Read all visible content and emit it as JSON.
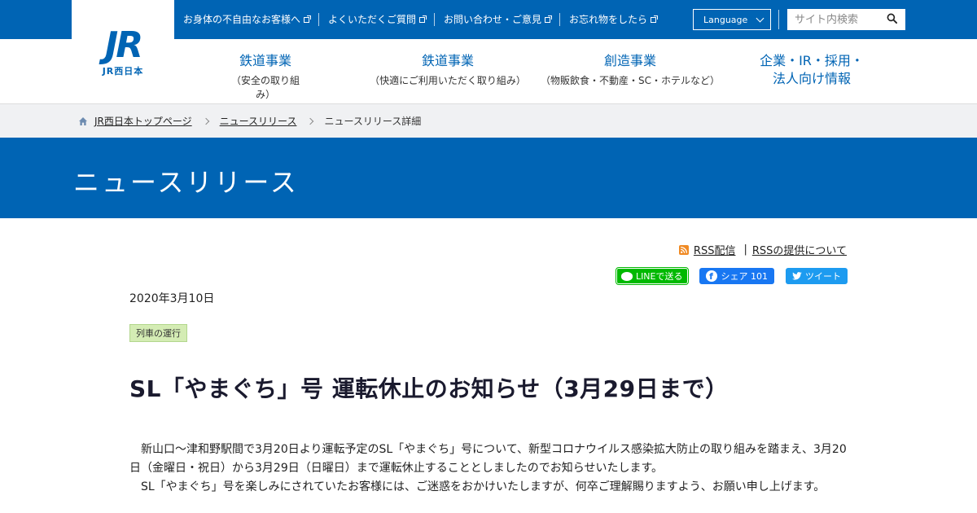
{
  "brand": {
    "logo_text": "JR",
    "logo_sub": "JR西日本"
  },
  "utility_links": [
    {
      "label": "お身体の不自由なお客様へ"
    },
    {
      "label": "よくいただくご質問"
    },
    {
      "label": "お問い合わせ・ご意見"
    },
    {
      "label": "お忘れ物をしたら"
    }
  ],
  "language": {
    "label": "Language"
  },
  "search": {
    "placeholder": "サイト内検索"
  },
  "main_nav": [
    {
      "title": "鉄道事業",
      "sub": "（安全の取り組み）"
    },
    {
      "title": "鉄道事業",
      "sub": "（快適にご利用いただく取り組み）"
    },
    {
      "title": "創造事業",
      "sub": "（物販飲食・不動産・SC・ホテルなど）"
    },
    {
      "title": "企業・IR・採用・",
      "title2": "法人向け情報"
    }
  ],
  "breadcrumb": {
    "home": "JR西日本トップページ",
    "level1": "ニュースリリース",
    "current": "ニュースリリース詳細"
  },
  "hero": {
    "title": "ニュースリリース"
  },
  "rss": {
    "feed": "RSS配信",
    "separator": "|",
    "about": "RSSの提供について"
  },
  "share": {
    "line": "LINEで送る",
    "facebook": "シェア 101",
    "twitter": "ツイート"
  },
  "article": {
    "date": "2020年3月10日",
    "tag": "列車の運行",
    "title": "SL「やまぐち」号 運転休止のお知らせ（3月29日まで）",
    "paragraphs": [
      "新山口～津和野駅間で3月20日より運転予定のSL「やまぐち」号について、新型コロナウイルス感染拡大防止の取り組みを踏まえ、3月20日（金曜日・祝日）から3月29日（日曜日）まで運転休止することとしましたのでお知らせいたします。",
      "SL「やまぐち」号を楽しみにされていたお客様には、ご迷惑をおかけいたしますが、何卒ご理解賜りますよう、お願い申し上げます。"
    ]
  },
  "colors": {
    "brand_blue": "#0064b4",
    "tag_green": "#d4ecb4",
    "line_green": "#00b900",
    "facebook_blue": "#1877f2",
    "twitter_blue": "#1d9bf0"
  }
}
